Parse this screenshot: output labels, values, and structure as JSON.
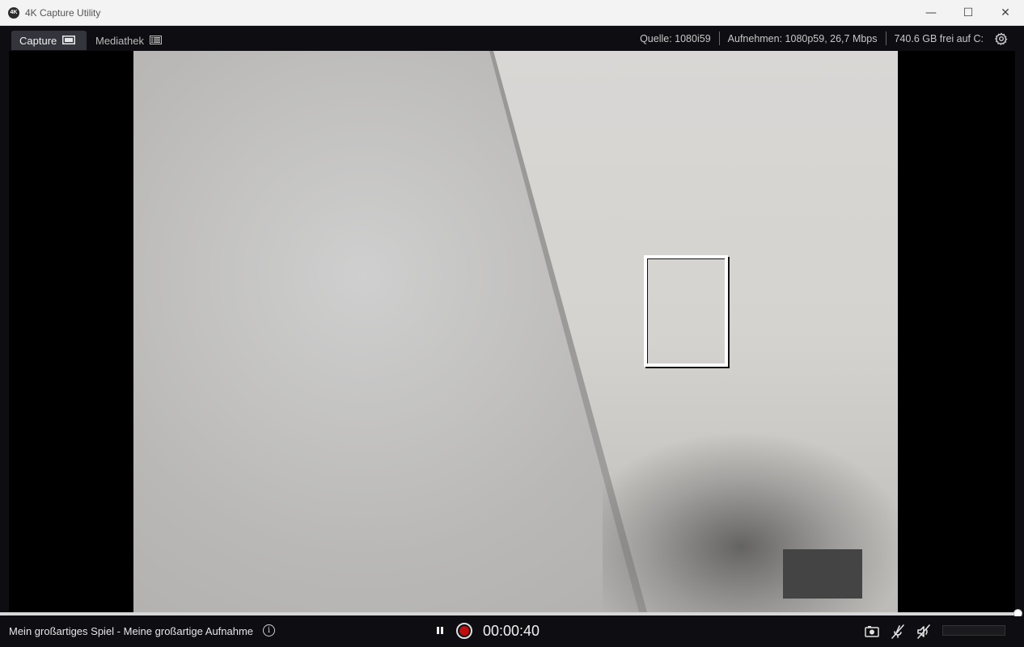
{
  "window": {
    "title": "4K Capture Utility",
    "icon_text": "4K",
    "minimize_glyph": "—",
    "maximize_glyph": "☐",
    "close_glyph": "✕"
  },
  "tabs": [
    {
      "label": "Capture",
      "icon": "monitor-icon",
      "active": true
    },
    {
      "label": "Mediathek",
      "icon": "grid-list-icon",
      "active": false
    }
  ],
  "status": {
    "source": "Quelle: 1080i59",
    "recording": "Aufnehmen: 1080p59, 26,7 Mbps",
    "storage": "740.6 GB frei auf C:"
  },
  "bottom": {
    "recording_title": "Mein großartiges Spiel - Meine großartige Aufnahme",
    "info_glyph": "i",
    "timer": "00:00:40",
    "progress": 1.0
  },
  "icons": {
    "settings": "gear-icon",
    "screenshot": "camera-icon",
    "mic_muted": "mic-muted-icon",
    "speaker_muted": "speaker-muted-icon"
  },
  "colors": {
    "background": "#0d0d12",
    "active_tab": "#33343c",
    "record_red": "#c00d0d"
  }
}
